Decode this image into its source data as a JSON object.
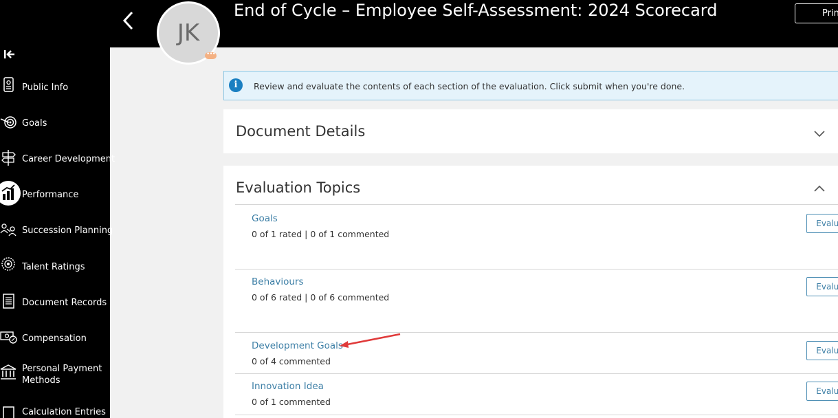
{
  "header": {
    "title": "End of Cycle – Employee Self-Assessment: 2024 Scorecard",
    "print_label": "Print",
    "avatar_initials": "JK",
    "avatar_badge": "•••"
  },
  "sidebar": {
    "items": [
      {
        "label": "Public Info",
        "icon": "id-badge-icon"
      },
      {
        "label": "Goals",
        "icon": "target-icon"
      },
      {
        "label": "Career Development",
        "icon": "signpost-icon"
      },
      {
        "label": "Performance",
        "icon": "bar-chart-icon",
        "active": true
      },
      {
        "label": "Succession Planning",
        "icon": "people-arrows-icon"
      },
      {
        "label": "Talent Ratings",
        "icon": "rating-badge-icon"
      },
      {
        "label": "Document Records",
        "icon": "document-icon"
      },
      {
        "label": "Compensation",
        "icon": "money-icon"
      },
      {
        "label": "Personal Payment Methods",
        "icon": "bank-icon"
      },
      {
        "label": "Calculation Entries",
        "icon": "calculator-icon"
      }
    ]
  },
  "banner": {
    "text": "Review and evaluate the contents of each section of the evaluation. Click submit when you're done."
  },
  "document_details": {
    "title": "Document Details"
  },
  "evaluation_topics": {
    "title": "Evaluation Topics",
    "topics": [
      {
        "name": "Goals",
        "status": "0 of 1 rated | 0 of 1 commented",
        "button": "Evaluate"
      },
      {
        "name": "Behaviours",
        "status": "0 of 6 rated | 0 of 6 commented",
        "button": "Evaluate"
      },
      {
        "name": "Development Goals",
        "status": "0 of 4 commented",
        "button": "Evaluate"
      },
      {
        "name": "Innovation Idea",
        "status": "0 of 1 commented",
        "button": "Evaluate"
      }
    ]
  },
  "colors": {
    "link": "#3d7fa6",
    "banner_bg": "#e5f3fb",
    "annotation_arrow": "#e03a3a"
  }
}
